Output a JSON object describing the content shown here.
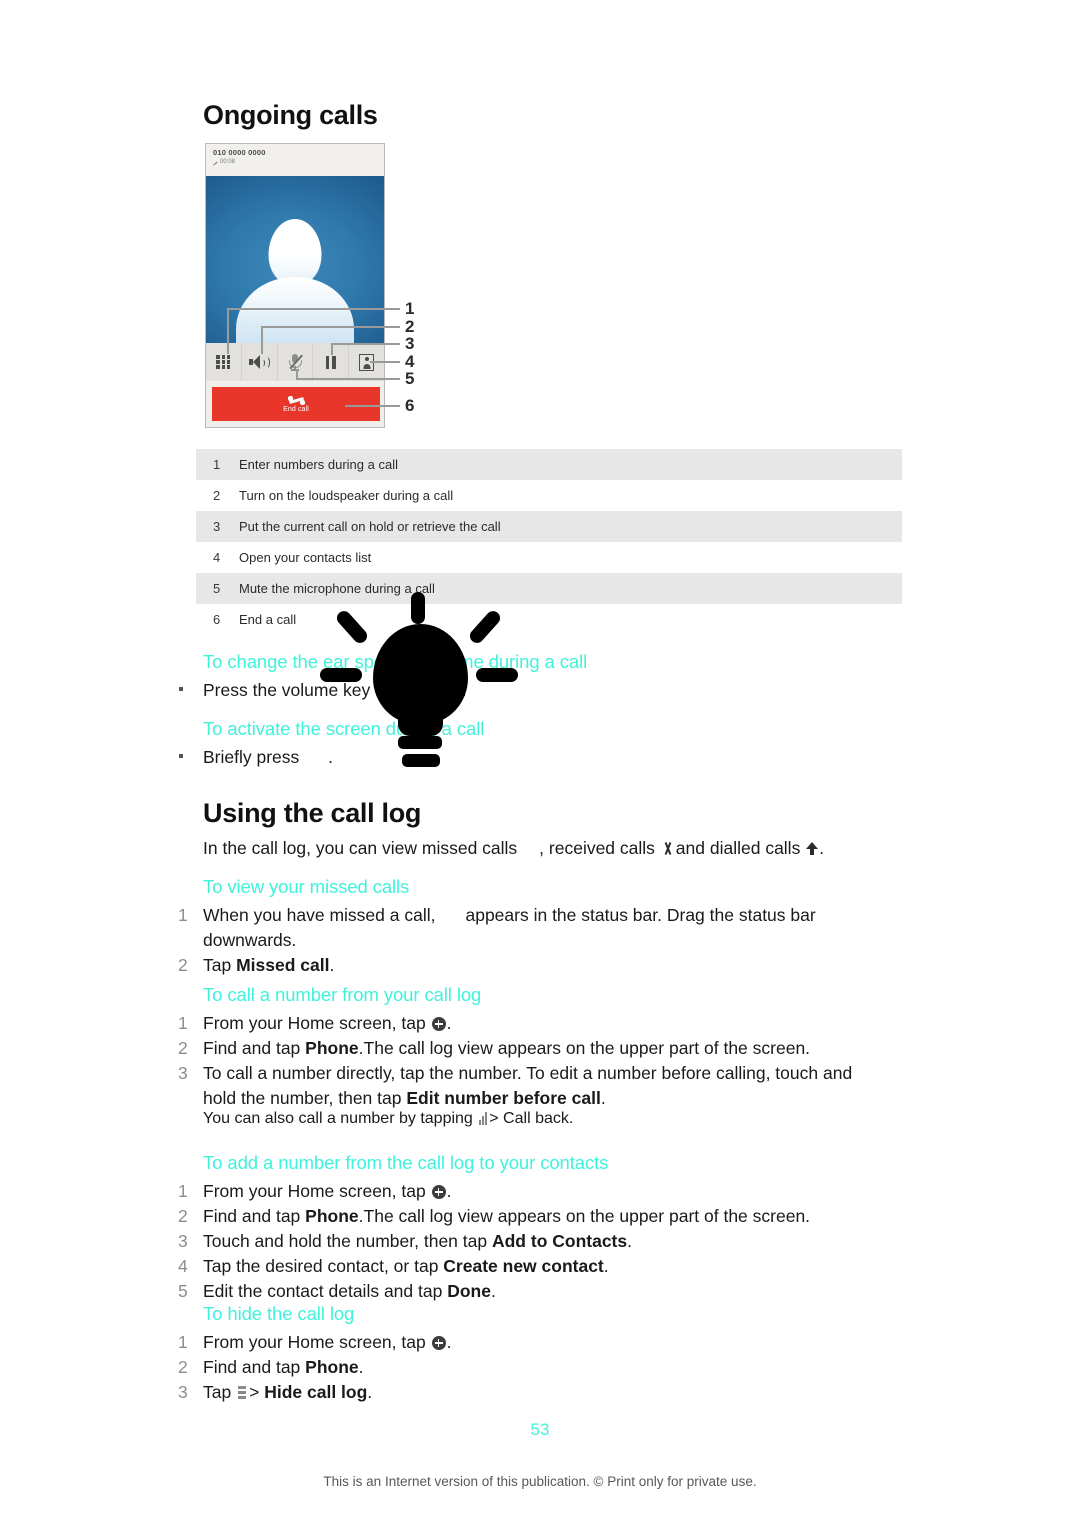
{
  "document": {
    "page_number": "53",
    "footer_note": "This is an Internet version of this publication. © Print only for private use.",
    "accent_color": "#3ff2da"
  },
  "sections": {
    "ongoing_calls": {
      "title": "Ongoing calls",
      "phone_mock": {
        "number": "010 0000 0000",
        "timer": "00:08",
        "end_call_label": "End call",
        "toolbar_icons": [
          "keypad-icon",
          "speaker-icon",
          "mic-muted-icon",
          "pause-icon",
          "contacts-icon"
        ],
        "callout_numbers": [
          "1",
          "2",
          "3",
          "4",
          "5",
          "6"
        ]
      },
      "legend": [
        {
          "num": "1",
          "text": "Enter numbers during a call"
        },
        {
          "num": "2",
          "text": "Turn on the loudspeaker during a call"
        },
        {
          "num": "3",
          "text": "Put the current call on hold or retrieve the call"
        },
        {
          "num": "4",
          "text": "Open your contacts list"
        },
        {
          "num": "5",
          "text": "Mute the microphone during a call"
        },
        {
          "num": "6",
          "text": "End a call"
        }
      ],
      "tip_ear_speaker": {
        "heading": "To change the ear speaker volume during a call",
        "bullet": "Press the volume key up or down."
      },
      "tip_activate_screen": {
        "heading": "To activate the screen during a call",
        "bullet_prefix": "Briefly press",
        "bullet_suffix": "."
      }
    },
    "using_call_log": {
      "title": "Using the call log",
      "intro_part1": "In the call log, you can view missed calls",
      "intro_part2": ", received calls",
      "intro_part3": "and dialled calls",
      "intro_part4": ".",
      "view_missed": {
        "heading": "To view your missed calls",
        "steps": [
          {
            "num": "1",
            "prefix": "When you have missed a call,",
            "mid": "appears in the status bar. Drag the status bar downwards.",
            "suffix": ""
          },
          {
            "num": "2",
            "prefix": "Tap",
            "bold": "Missed call",
            "suffix": "."
          }
        ]
      },
      "call_number": {
        "heading": "To call a number from your call log",
        "steps": [
          {
            "num": "1",
            "prefix": "From your Home screen, tap",
            "suffix": "."
          },
          {
            "num": "2",
            "prefix": "Find and tap",
            "bold": "Phone",
            "suffix": ".The call log view appears on the upper part of the screen."
          },
          {
            "num": "3",
            "prefix": "To call a number directly, tap the number. To edit a number before calling, touch and hold the number, then tap",
            "bold": "Edit number before call",
            "suffix": "."
          }
        ],
        "note_prefix": "You can also call a number by tapping",
        "note_suffix": "> Call back."
      },
      "add_number": {
        "heading": "To add a number from the call log to your contacts",
        "steps": [
          {
            "num": "1",
            "prefix": "From your Home screen, tap",
            "suffix": "."
          },
          {
            "num": "2",
            "prefix": "Find and tap",
            "bold": "Phone",
            "suffix": ".The call log view appears on the upper part of the screen."
          },
          {
            "num": "3",
            "prefix": "Touch and hold the number, then tap",
            "bold": "Add to Contacts",
            "suffix": "."
          },
          {
            "num": "4",
            "prefix": "Tap the desired contact, or tap",
            "bold": "Create new contact",
            "suffix": "."
          },
          {
            "num": "5",
            "prefix": "Edit the contact details and tap",
            "bold": "Done",
            "suffix": "."
          }
        ]
      },
      "hide_log": {
        "heading": "To hide the call log",
        "steps": [
          {
            "num": "1",
            "prefix": "From your Home screen, tap",
            "suffix": "."
          },
          {
            "num": "2",
            "prefix": "Find and tap",
            "bold": "Phone",
            "suffix": "."
          },
          {
            "num": "3",
            "prefix": "Tap",
            "mid": ">",
            "bold": "Hide call log",
            "suffix": "."
          }
        ]
      }
    }
  }
}
